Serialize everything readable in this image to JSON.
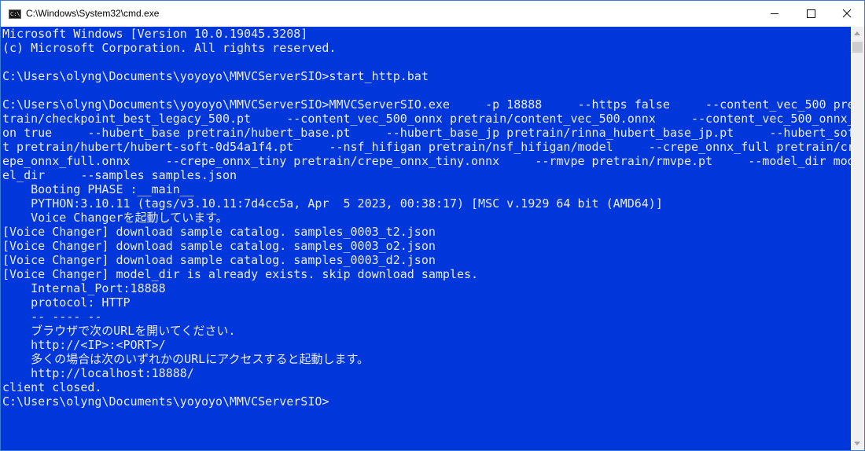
{
  "window": {
    "title": "C:\\Windows\\System32\\cmd.exe",
    "icon": "cmd-icon",
    "buttons": {
      "minimize": "minimize-icon",
      "maximize": "maximize-icon",
      "close": "close-icon"
    }
  },
  "colors": {
    "console_background": "#0037da",
    "console_text": "#ececec",
    "titlebar": "#ffffff",
    "scrollbar": "#f0f0f0"
  },
  "console": {
    "lines": [
      "Microsoft Windows [Version 10.0.19045.3208]",
      "(c) Microsoft Corporation. All rights reserved.",
      "",
      "C:\\Users\\olyng\\Documents\\yoyoyo\\MMVCServerSIO>start_http.bat",
      "",
      "C:\\Users\\olyng\\Documents\\yoyoyo\\MMVCServerSIO>MMVCServerSIO.exe     -p 18888     --https false     --content_vec_500 pre",
      "train/checkpoint_best_legacy_500.pt     --content_vec_500_onnx pretrain/content_vec_500.onnx     --content_vec_500_onnx_",
      "on true     --hubert_base pretrain/hubert_base.pt     --hubert_base_jp pretrain/rinna_hubert_base_jp.pt     --hubert_sof",
      "t pretrain/hubert/hubert-soft-0d54a1f4.pt     --nsf_hifigan pretrain/nsf_hifigan/model     --crepe_onnx_full pretrain/cr",
      "epe_onnx_full.onnx     --crepe_onnx_tiny pretrain/crepe_onnx_tiny.onnx     --rmvpe pretrain/rmvpe.pt     --model_dir mod",
      "el_dir     --samples samples.json",
      "    Booting PHASE :__main__",
      "    PYTHON:3.10.11 (tags/v3.10.11:7d4cc5a, Apr  5 2023, 00:38:17) [MSC v.1929 64 bit (AMD64)]",
      "    Voice Changerを起動しています。",
      "[Voice Changer] download sample catalog. samples_0003_t2.json",
      "[Voice Changer] download sample catalog. samples_0003_o2.json",
      "[Voice Changer] download sample catalog. samples_0003_d2.json",
      "[Voice Changer] model_dir is already exists. skip download samples.",
      "    Internal_Port:18888",
      "    protocol: HTTP",
      "    -- ---- --",
      "    ブラウザで次のURLを開いてください.",
      "    http://<IP>:<PORT>/",
      "    多くの場合は次のいずれかのURLにアクセスすると起動します。",
      "    http://localhost:18888/",
      "client closed.",
      "C:\\Users\\olyng\\Documents\\yoyoyo\\MMVCServerSIO>"
    ]
  }
}
